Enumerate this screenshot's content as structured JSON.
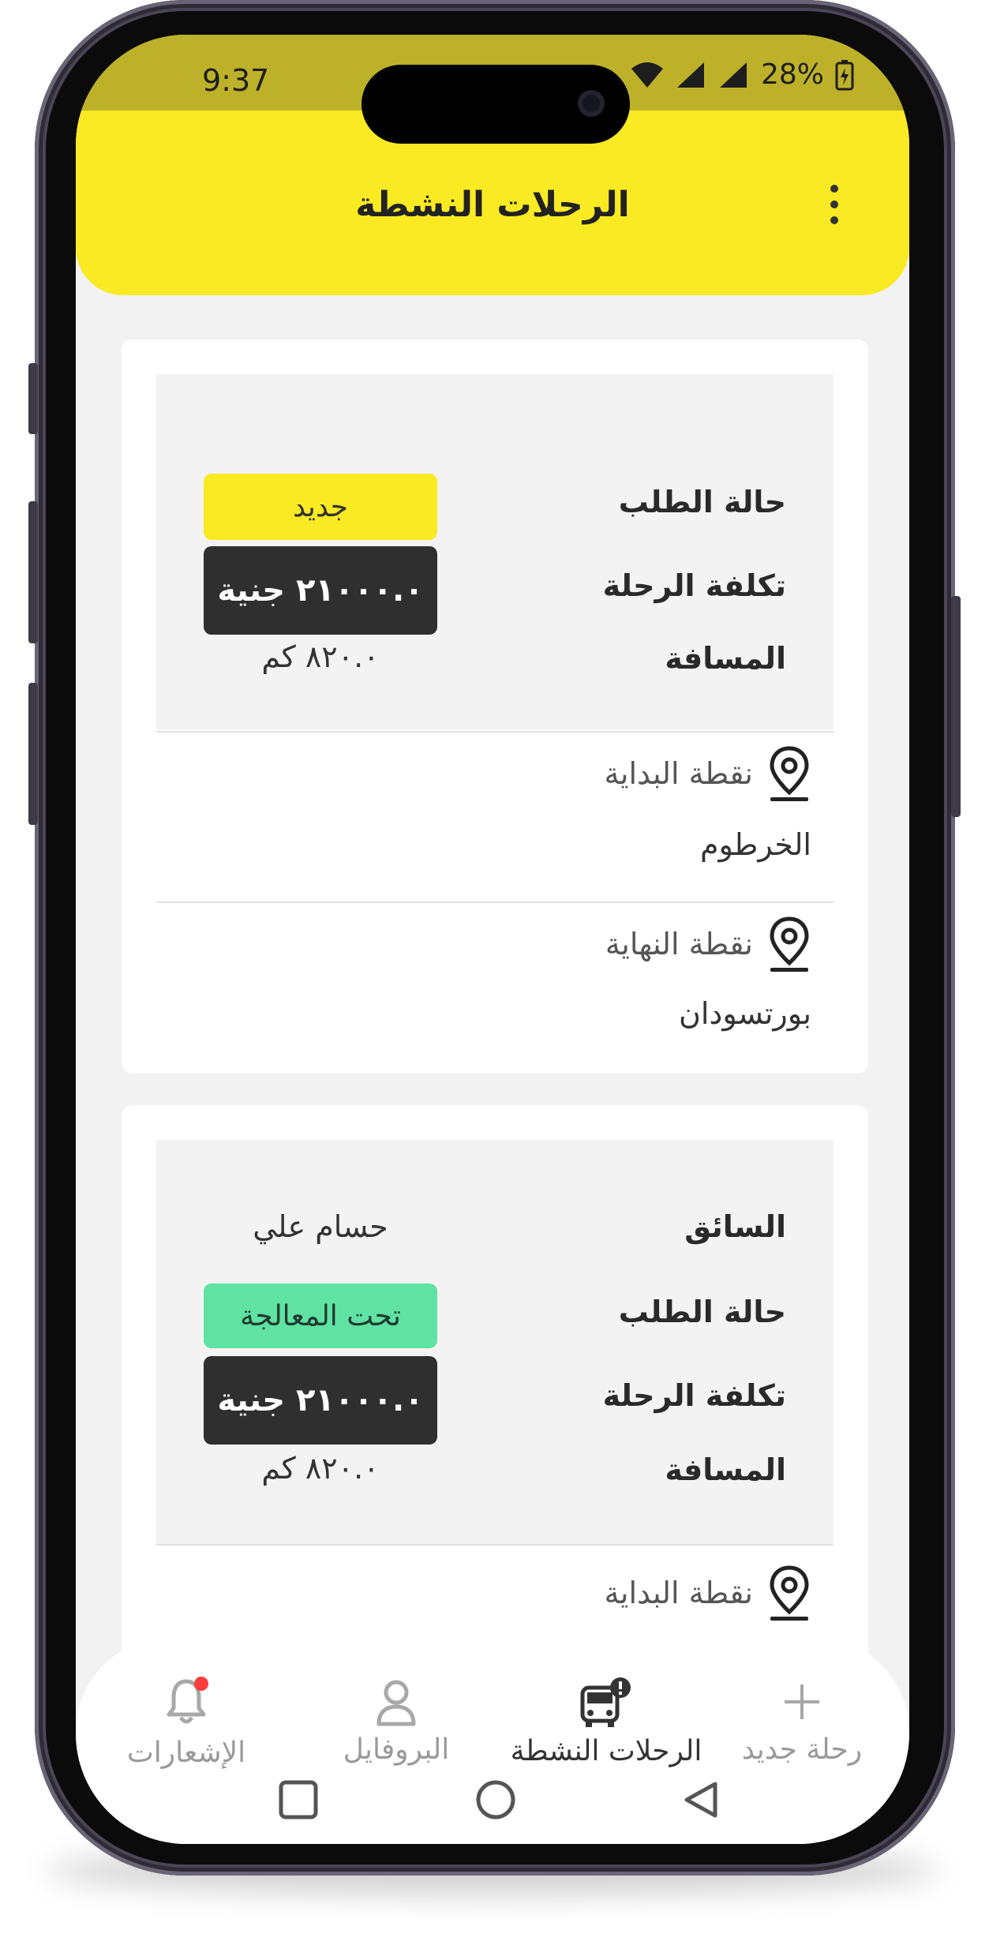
{
  "status_bar": {
    "time": "9:37",
    "battery": "28%"
  },
  "header": {
    "title": "الرحلات النشطة"
  },
  "trips": [
    {
      "status_label": "حالة الطلب",
      "status_value": "جديد",
      "cost_label": "تكلفة الرحلة",
      "cost_value": "٢١٠٠٠.٠ جنية",
      "distance_label": "المسافة",
      "distance_value": "٨٢٠.٠ كم",
      "start_label": "نقطة البداية",
      "start_value": "الخرطوم",
      "end_label": "نقطة النهاية",
      "end_value": "بورتسودان"
    },
    {
      "driver_label": "السائق",
      "driver_value": "حسام علي",
      "status_label": "حالة الطلب",
      "status_value": "تحت المعالجة",
      "cost_label": "تكلفة الرحلة",
      "cost_value": "٢١٠٠٠.٠ جنية",
      "distance_label": "المسافة",
      "distance_value": "٨٢٠.٠ كم",
      "start_label": "نقطة البداية"
    }
  ],
  "bottom_nav": {
    "notifications": "الإشعارات",
    "profile": "البروفايل",
    "active_trips": "الرحلات النشطة",
    "new_trip": "رحلة جديد"
  },
  "colors": {
    "accent_yellow": "#f9ea23",
    "processing_green": "#5fe2a2",
    "cost_dark": "#2f2f2f",
    "notification_dot": "#ff3b3b"
  }
}
